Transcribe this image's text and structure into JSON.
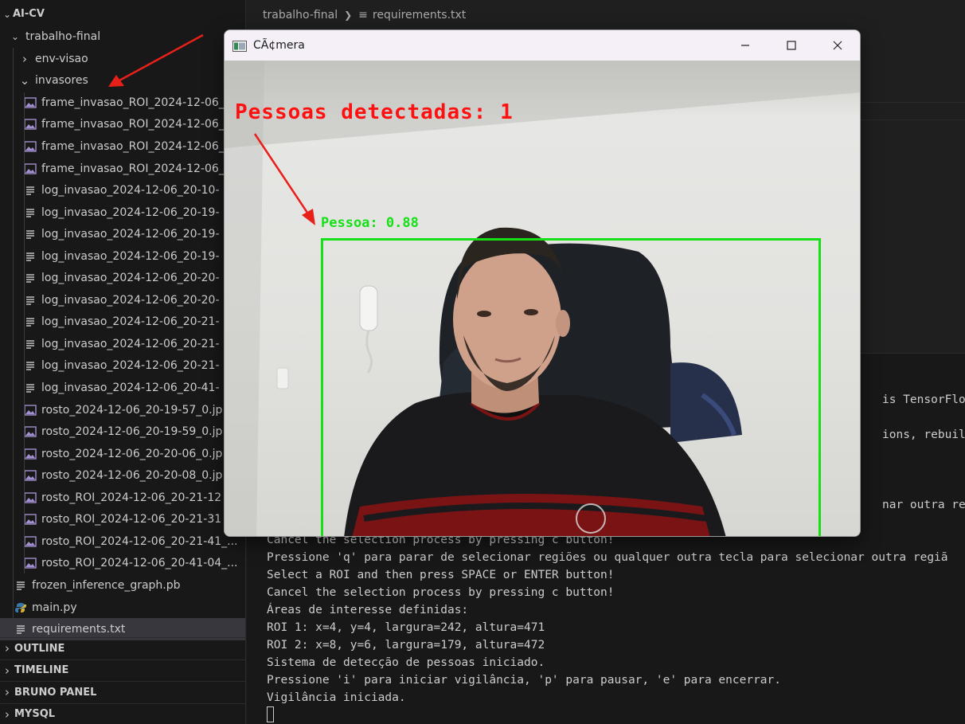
{
  "explorer": {
    "root": "AI-CV",
    "folder": "trabalho-final",
    "items": [
      {
        "label": "env-visao",
        "type": "folder-collapsed"
      },
      {
        "label": "invasores",
        "type": "folder-open"
      },
      {
        "label": "frame_invasao_ROI_2024-12-06_",
        "type": "image"
      },
      {
        "label": "frame_invasao_ROI_2024-12-06_",
        "type": "image"
      },
      {
        "label": "frame_invasao_ROI_2024-12-06_",
        "type": "image"
      },
      {
        "label": "frame_invasao_ROI_2024-12-06_",
        "type": "image"
      },
      {
        "label": "log_invasao_2024-12-06_20-10-",
        "type": "text"
      },
      {
        "label": "log_invasao_2024-12-06_20-19-",
        "type": "text"
      },
      {
        "label": "log_invasao_2024-12-06_20-19-",
        "type": "text"
      },
      {
        "label": "log_invasao_2024-12-06_20-19-",
        "type": "text"
      },
      {
        "label": "log_invasao_2024-12-06_20-20-",
        "type": "text"
      },
      {
        "label": "log_invasao_2024-12-06_20-20-",
        "type": "text"
      },
      {
        "label": "log_invasao_2024-12-06_20-21-",
        "type": "text"
      },
      {
        "label": "log_invasao_2024-12-06_20-21-",
        "type": "text"
      },
      {
        "label": "log_invasao_2024-12-06_20-21-",
        "type": "text"
      },
      {
        "label": "log_invasao_2024-12-06_20-41-",
        "type": "text"
      },
      {
        "label": "rosto_2024-12-06_20-19-57_0.jp",
        "type": "image"
      },
      {
        "label": "rosto_2024-12-06_20-19-59_0.jp",
        "type": "image"
      },
      {
        "label": "rosto_2024-12-06_20-20-06_0.jp",
        "type": "image"
      },
      {
        "label": "rosto_2024-12-06_20-20-08_0.jp",
        "type": "image"
      },
      {
        "label": "rosto_ROI_2024-12-06_20-21-12",
        "type": "image"
      },
      {
        "label": "rosto_ROI_2024-12-06_20-21-31",
        "type": "image"
      },
      {
        "label": "rosto_ROI_2024-12-06_20-21-41_...",
        "type": "image"
      },
      {
        "label": "rosto_ROI_2024-12-06_20-41-04_...",
        "type": "image"
      },
      {
        "label": "frozen_inference_graph.pb",
        "type": "text"
      },
      {
        "label": "main.py",
        "type": "python"
      },
      {
        "label": "requirements.txt",
        "type": "text",
        "selected": true
      }
    ],
    "sections": [
      "OUTLINE",
      "TIMELINE",
      "BRUNO PANEL",
      "MYSQL"
    ]
  },
  "breadcrumb": {
    "folder": "trabalho-final",
    "file": "requirements.txt"
  },
  "terminal": {
    "partial_lines": [
      "is TensorFlow b",
      "ions, rebuild T",
      "nar outra regiã"
    ],
    "lines": [
      "Cancel the selection process by pressing c button!",
      "Pressione 'q' para parar de selecionar regiões ou qualquer outra tecla para selecionar outra regiã",
      "Select a ROI and then press SPACE or ENTER button!",
      "Cancel the selection process by pressing c button!",
      "Áreas de interesse definidas:",
      "ROI 1: x=4, y=4, largura=242, altura=471",
      "ROI 2: x=8, y=6, largura=179, altura=472",
      "Sistema de detecção de pessoas iniciado.",
      "Pressione 'i' para iniciar vigilância, 'p' para pausar, 'e' para encerrar.",
      "Vigilância iniciada."
    ]
  },
  "camera_window": {
    "title": "CÃ¢mera",
    "overlay_count": "Pessoas detectadas: 1",
    "detection_label": "Pessoa: 0.88",
    "colors": {
      "count_text": "#ff1010",
      "detection": "#16e016"
    }
  },
  "icons": [
    "chevron-down-icon",
    "chevron-right-icon",
    "image-file-icon",
    "text-file-icon",
    "python-file-icon",
    "window-app-icon",
    "minimize-icon",
    "maximize-icon",
    "close-icon",
    "annotation-arrow-icon"
  ]
}
